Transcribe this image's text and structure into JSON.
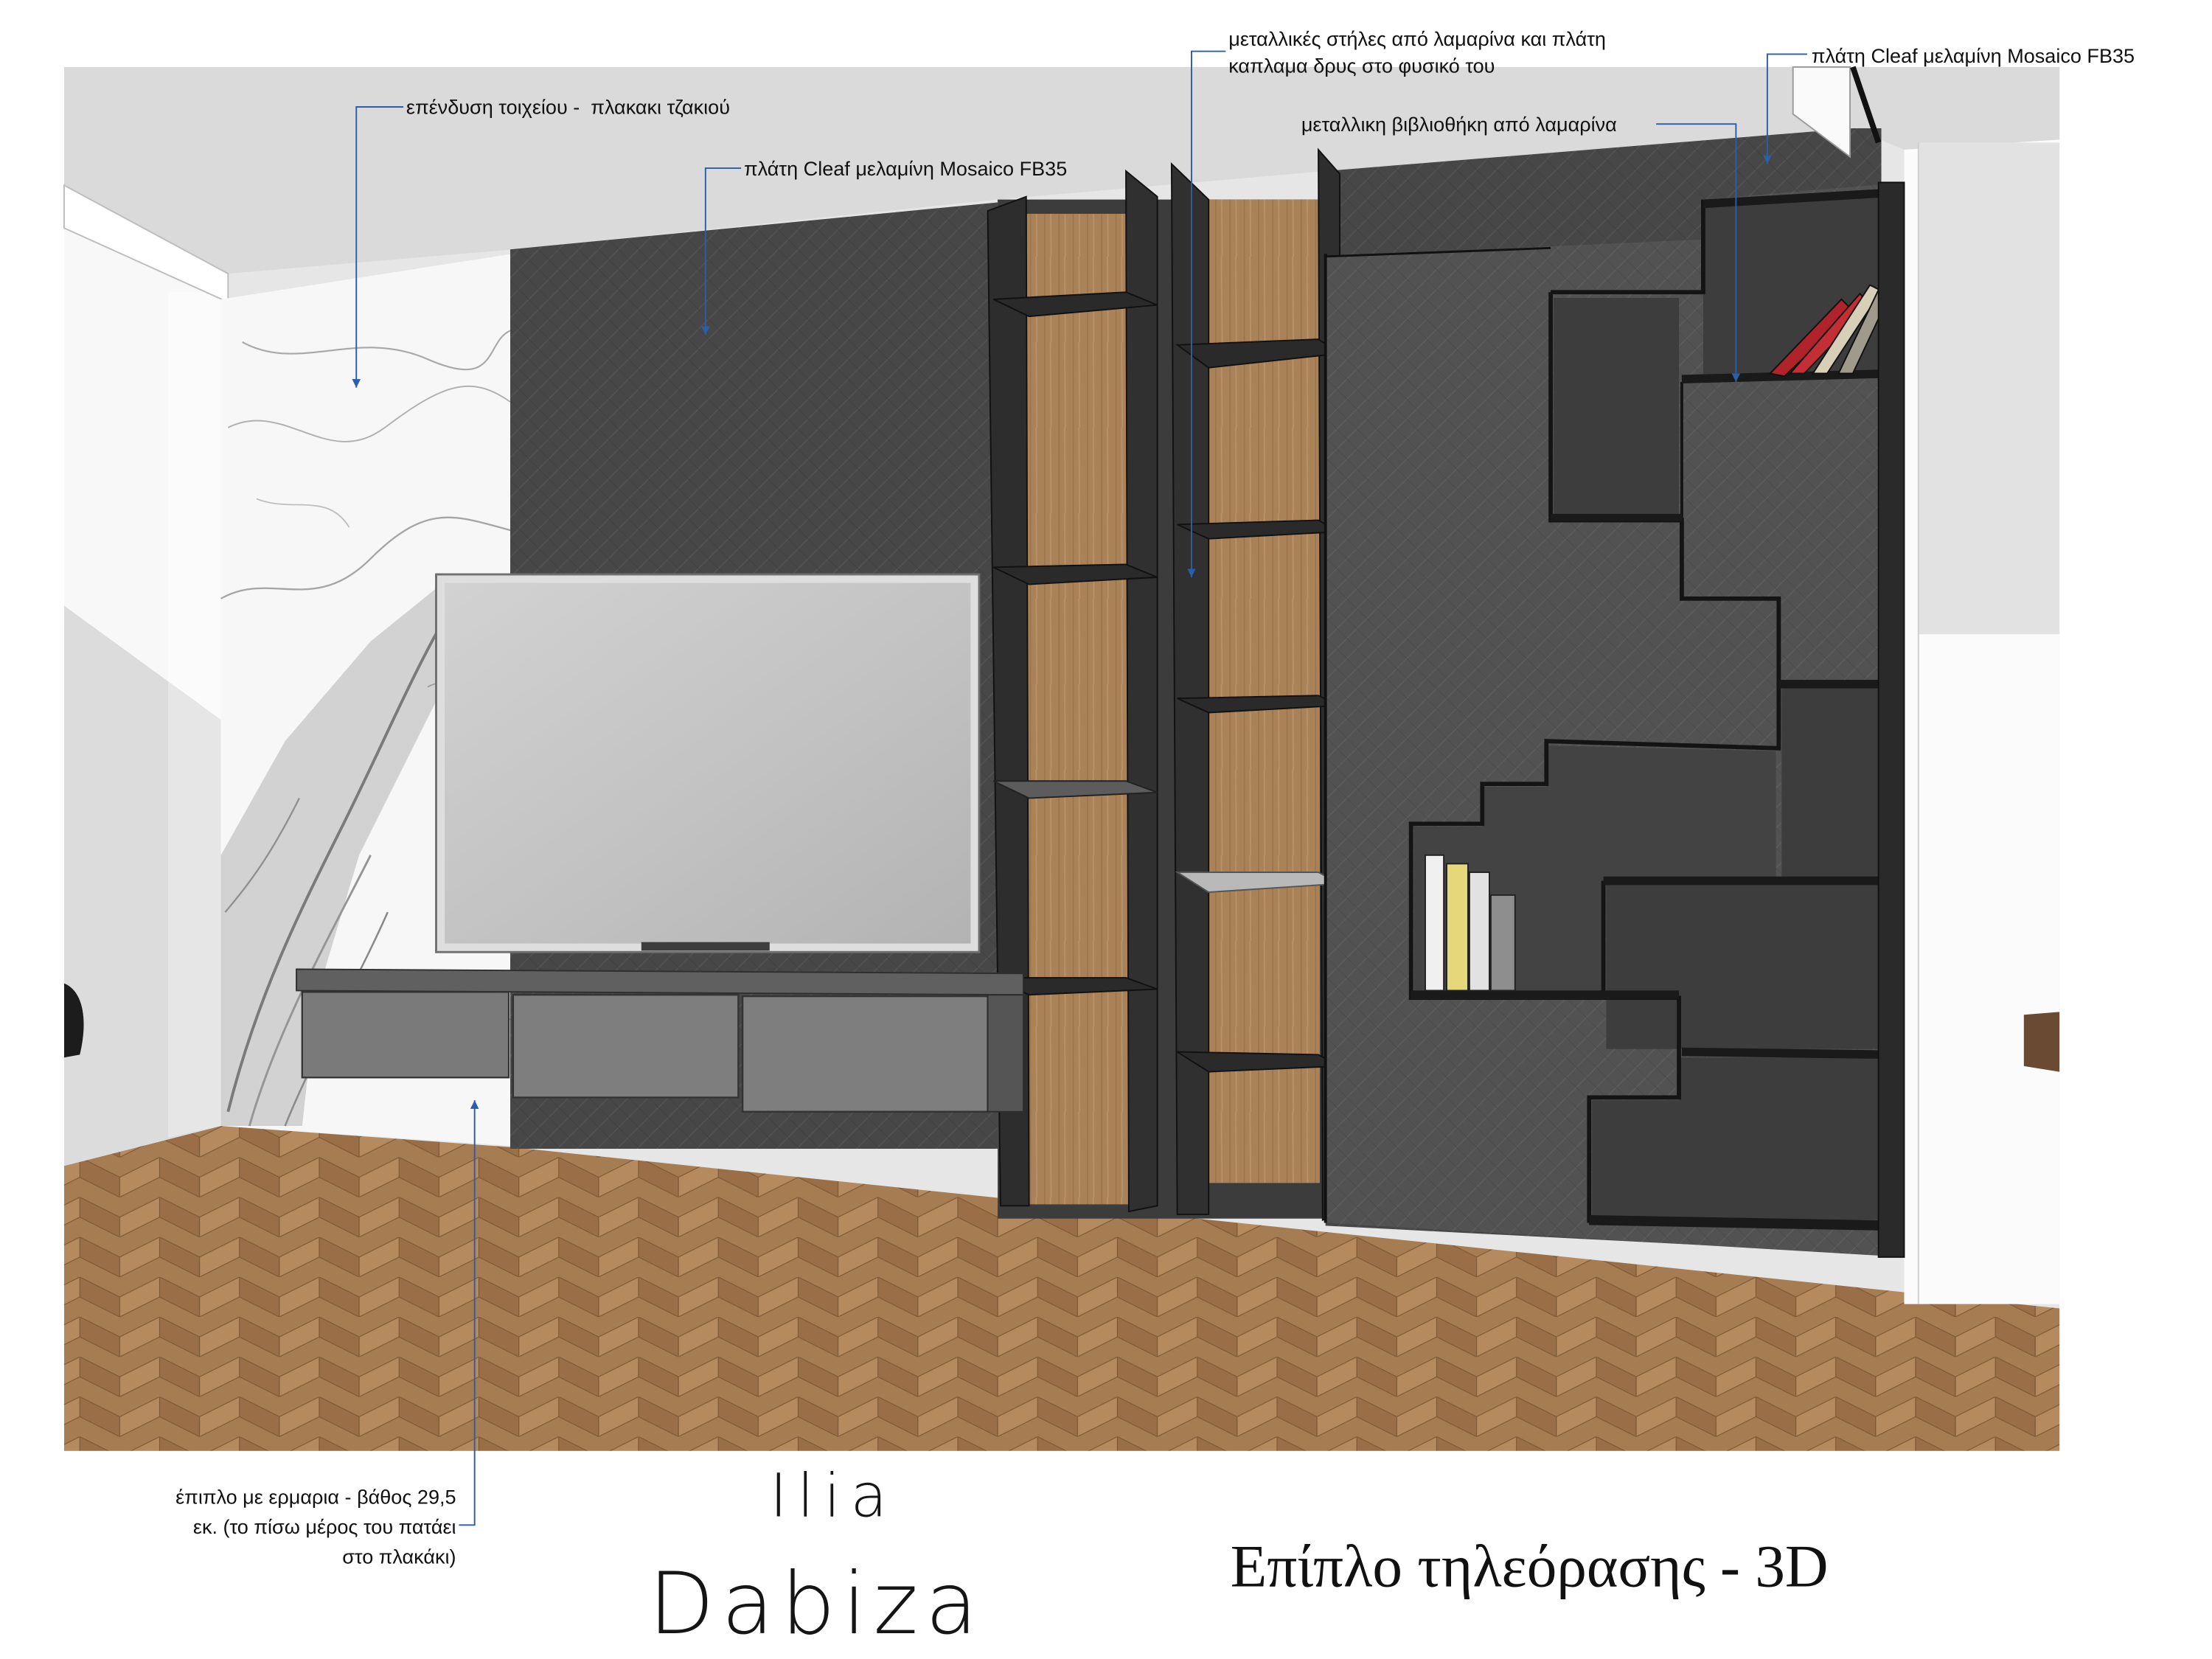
{
  "annotations": {
    "wall_cladding": "επένδυση τοιχείου -  πλακακι τζακιού",
    "back_panel_left": "πλάτη Cleaf μελαμίνη Mosaico FB35",
    "metal_columns_line1": "μεταλλικές στήλες από λαμαρίνα και πλάτη",
    "metal_columns_line2": "καπλαμα δρυς στο φυσικό του",
    "back_panel_right": "πλάτη Cleaf μελαμίνη Mosaico FB35",
    "metal_bookcase": "μεταλλικη βιβλιοθήκη από λαμαρίνα",
    "cabinet_line1": "έπιπλο με ερμαρια - βάθος 29,5",
    "cabinet_line2": "εκ. (το πίσω μέρος του πατάει",
    "cabinet_line3": "στο πλακάκι)"
  },
  "signature": {
    "first": "Ilia",
    "last": "Dabiza"
  },
  "title": "Επίπλο τηλεόρασης - 3D",
  "colors": {
    "leader_line": "#2b5ea8",
    "dark_panel": "#4a4a4a",
    "oak_veneer": "#a98257",
    "floor_wood": "#a67c52",
    "metal": "#2a2a2a"
  }
}
